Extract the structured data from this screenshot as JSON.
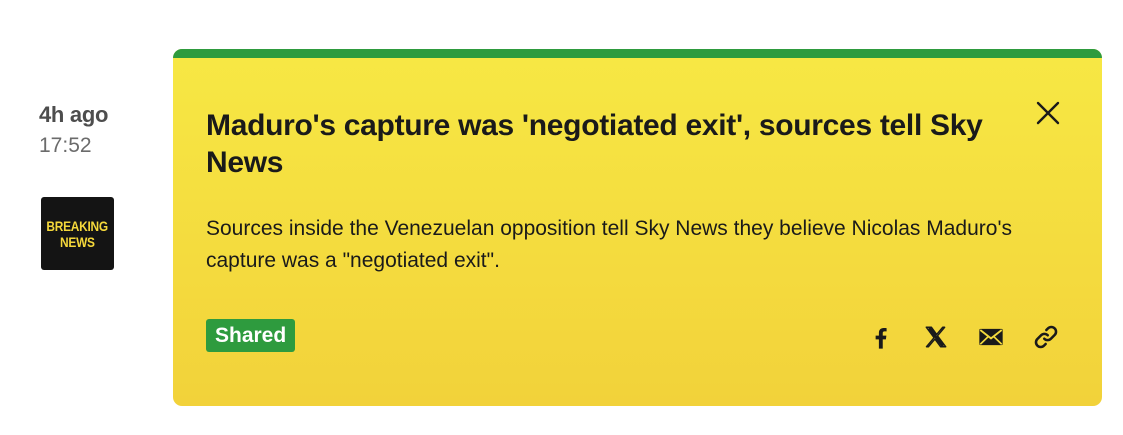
{
  "post": {
    "relative_time": "4h ago",
    "time": "17:52",
    "badge_line1": "BREAKING",
    "badge_line2": "NEWS"
  },
  "card": {
    "headline": "Maduro's capture was 'negotiated exit', sources tell Sky News",
    "body": "Sources inside the Venezuelan opposition tell Sky News they believe Nicolas Maduro's capture was a \"negotiated exit\".",
    "status_badge": "Shared",
    "share_icons": [
      "facebook-icon",
      "x-icon",
      "email-icon",
      "link-icon"
    ]
  },
  "colors": {
    "card_yellow": "#f5df40",
    "accent_green": "#2e9b3e",
    "breaking_bg": "#141414",
    "breaking_text": "#f5d83b"
  }
}
